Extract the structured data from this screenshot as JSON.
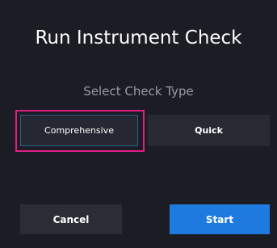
{
  "dialog": {
    "title": "Run Instrument Check",
    "subtitle": "Select Check Type",
    "options": [
      {
        "label": "Comprehensive",
        "selected": true
      },
      {
        "label": "Quick",
        "selected": false
      }
    ],
    "buttons": {
      "cancel_label": "Cancel",
      "start_label": "Start"
    }
  },
  "colors": {
    "background": "#1b1c24",
    "highlight": "#e21d86",
    "primary": "#1f7ae0",
    "selected_border": "#2f5f8a"
  }
}
